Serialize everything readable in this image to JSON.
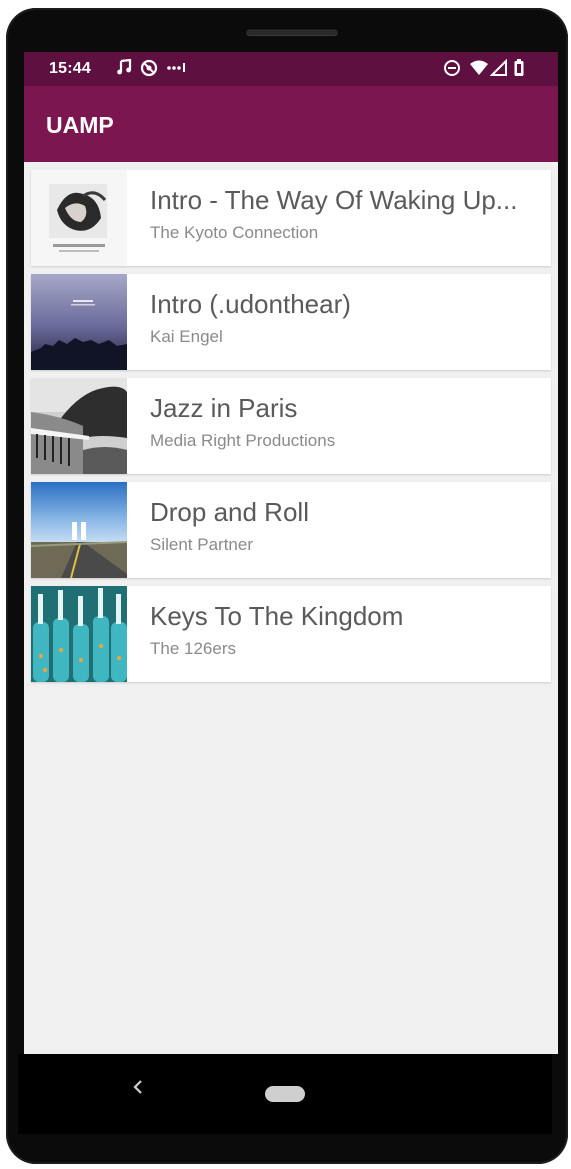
{
  "status_bar": {
    "time": "15:44",
    "left_icons": [
      "music-note-icon",
      "no-location-icon",
      "more-dots-icon"
    ],
    "right_icons": [
      "do-not-disturb-icon",
      "wifi-icon",
      "cell-signal-icon",
      "battery-icon"
    ]
  },
  "app_bar": {
    "title": "UAMP",
    "color": "#7b1650",
    "status_color": "#5e1140"
  },
  "tracks": [
    {
      "title": "Intro - The Way Of Waking Up...",
      "artist": "The Kyoto Connection",
      "art_icon": "album-art-kyoto"
    },
    {
      "title": " Intro (.udonthear)",
      "artist": "Kai Engel",
      "art_icon": "album-art-night-city"
    },
    {
      "title": "Jazz in Paris",
      "artist": "Media Right Productions",
      "art_icon": "album-art-coast"
    },
    {
      "title": "Drop and Roll",
      "artist": "Silent Partner",
      "art_icon": "album-art-road",
      "playing": true,
      "playing_icon": "pause-icon"
    },
    {
      "title": "Keys To The Kingdom",
      "artist": "The 126ers",
      "art_icon": "album-art-bottles"
    }
  ],
  "nav_bar": {
    "back_icon": "back-chevron-icon",
    "home_icon": "home-pill-icon"
  }
}
